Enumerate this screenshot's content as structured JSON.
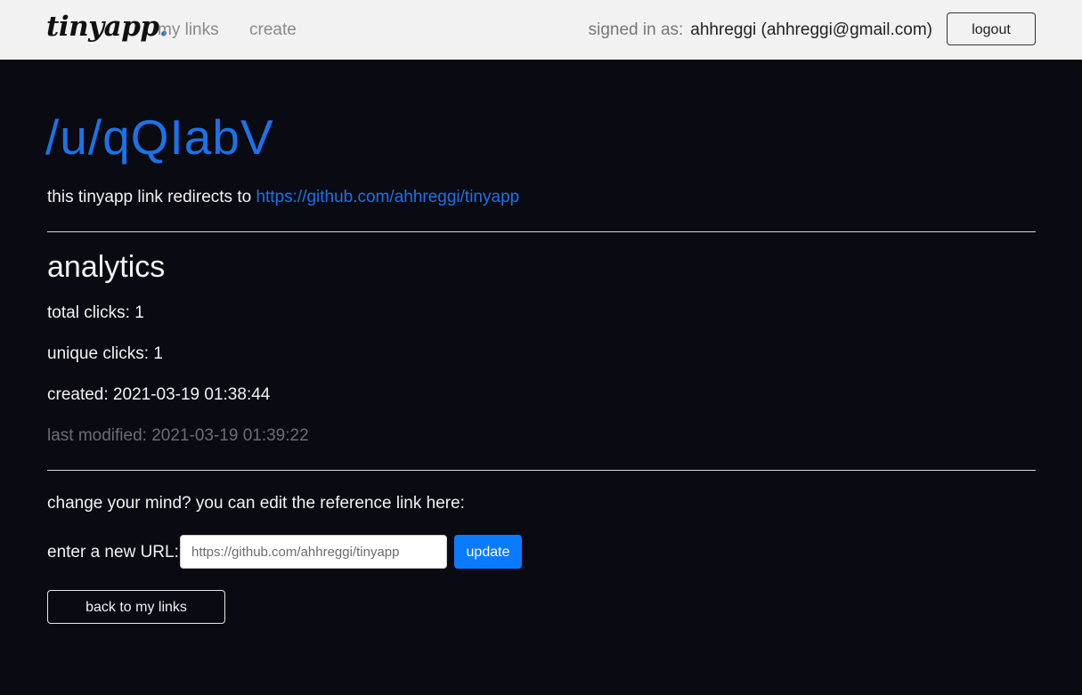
{
  "navbar": {
    "brand_text": "tinyapp",
    "brand_dot": ".",
    "links": {
      "my_links": "my links",
      "create": "create"
    },
    "signed_in_label": "signed in as:",
    "signed_in_user": "ahhreggi (ahhreggi@gmail.com)",
    "logout_label": "logout"
  },
  "main": {
    "title": "/u/qQIabV",
    "redirect_text": "this tinyapp link redirects to ",
    "redirect_url": "https://github.com/ahhreggi/tinyapp",
    "analytics": {
      "heading": "analytics",
      "total_clicks": "total clicks: 1",
      "unique_clicks": "unique clicks: 1",
      "created": "created: 2021-03-19 01:38:44",
      "last_modified": "last modified: 2021-03-19 01:39:22"
    },
    "edit": {
      "prompt": "change your mind? you can edit the reference link here:",
      "label": "enter a new URL:",
      "placeholder": "https://github.com/ahhreggi/tinyapp",
      "update_label": "update"
    },
    "back_label": "back to my links"
  },
  "colors": {
    "background": "#0a0a12",
    "navbar": "#f2f2f2",
    "accent": "#1a73e8",
    "button_primary": "#0a7bff"
  }
}
